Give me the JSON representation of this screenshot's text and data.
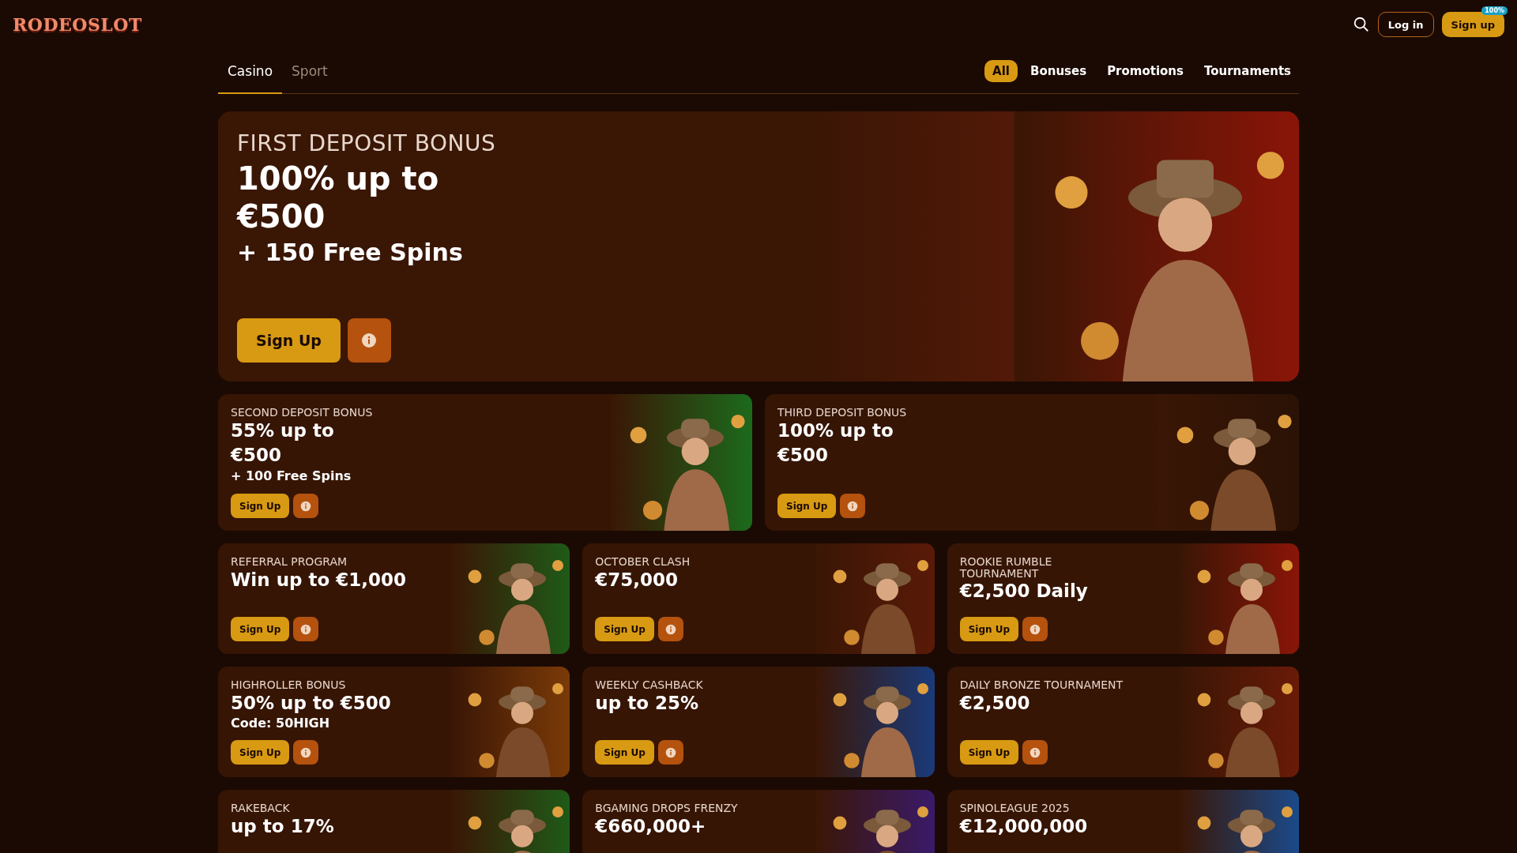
{
  "header": {
    "logo": "RODEOSLOT",
    "login": "Log in",
    "signup": "Sign up",
    "signup_badge": "100%"
  },
  "categories": [
    {
      "label": "Casino",
      "selected": true
    },
    {
      "label": "Sport",
      "selected": false
    }
  ],
  "filters": [
    {
      "label": "All",
      "selected": true
    },
    {
      "label": "Bonuses",
      "selected": false
    },
    {
      "label": "Promotions",
      "selected": false
    },
    {
      "label": "Tournaments",
      "selected": false
    }
  ],
  "hero": {
    "eyebrow": "FIRST DEPOSIT BONUS",
    "title": "100% up to €500",
    "subtitle": "+ 150 Free Spins",
    "button": "Sign Up"
  },
  "promo_rows": [
    {
      "cards": [
        {
          "category": "SECOND DEPOSIT BONUS",
          "title": "55% up to €500",
          "subtitle": "+ 100 Free Spins",
          "button": "Sign Up"
        },
        {
          "category": "THIRD DEPOSIT BONUS",
          "title": "100% up to €500",
          "button": "Sign Up"
        }
      ]
    },
    {
      "cards": [
        {
          "category": "REFERRAL PROGRAM",
          "title": "Win up to €1,000",
          "button": "Sign Up"
        },
        {
          "category": "OCTOBER CLASH",
          "title": "€75,000",
          "button": "Sign Up"
        },
        {
          "category": "ROOKIE RUMBLE TOURNAMENT",
          "title": "€2,500 Daily",
          "button": "Sign Up"
        }
      ]
    },
    {
      "cards": [
        {
          "category": "HIGHROLLER BONUS",
          "title": "50% up to €500",
          "subtitle": "Code: 50HIGH",
          "button": "Sign Up"
        },
        {
          "category": "WEEKLY CASHBACK",
          "title": "up to 25%",
          "button": "Sign Up"
        },
        {
          "category": "DAILY BRONZE TOURNAMENT",
          "title": "€2,500",
          "button": "Sign Up"
        }
      ]
    },
    {
      "cards": [
        {
          "category": "RAKEBACK",
          "title": "up to 17%"
        },
        {
          "category": "BGAMING DROPS FRENZY",
          "title": "€660,000+"
        },
        {
          "category": "SPINOLEAGUE 2025",
          "title": "€12,000,000"
        }
      ]
    }
  ]
}
